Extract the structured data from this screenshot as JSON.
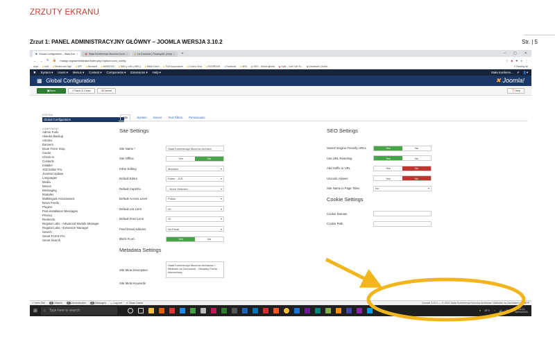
{
  "document": {
    "heading": "ZRZUTY EKRANU",
    "caption": "Zrzut 1: PANEL ADMINISTRACYJNY GŁÓWNY – JOOMLA WERSJA 3.10.2",
    "page": "Str. | 5"
  },
  "browser": {
    "tabs": [
      "Global Configuration – Stała Kon",
      "Stała Konferencja Muzeów Archi",
      "La Graciosa | Pewscycle, przep"
    ],
    "new_tab": "+",
    "url": "mabpp.org/administrator/index.php?option=com_config",
    "bookmarks": [
      "Apps",
      "m24",
      "Review and Sign",
      "SPF",
      "Microsoft",
      "WEBSITES",
      "NAS-y LAN-y WiFi-y",
      "Brexit Travel",
      "TCM Acupuncture",
      "Corona Virus",
      "FACEBOOK",
      "Facebook",
      "NRA",
      "SEO – Strona główna",
      "Kylie – Can't Get Yo...",
      "Dashboard | Action...",
      "Reading list"
    ]
  },
  "joomla": {
    "topmenu": [
      "System ▾",
      "Users ▾",
      "Menus ▾",
      "Content ▾",
      "Components ▾",
      "Extensions ▾",
      "Help ▾"
    ],
    "site_name_short": "Stała Konferen...",
    "title": "Global Configuration",
    "logo": "Joomla!",
    "toolbar": {
      "save": "Save",
      "save_close": "Save & Close",
      "cancel": "Cancel",
      "help": "Help"
    },
    "sidebar": {
      "system_label": "SYSTEM",
      "active": "Global Configuration",
      "component_label": "COMPONENT",
      "items": [
        "Admin Tools",
        "Akeeba Backup",
        "Articles",
        "Banners",
        "Brute Force Stop",
        "Cache",
        "Check-in",
        "Contacts",
        "Installer",
        "JCE Editor Pro",
        "Joomla! Update",
        "Languages",
        "Media",
        "Menus",
        "Messaging",
        "Modules",
        "Multilingual Associations",
        "News Feeds",
        "Plugins",
        "Post-installation Messages",
        "Privacy",
        "Redirects",
        "Regular Labs - Advanced Module Manager",
        "Regular Labs - Extension Manager",
        "Search",
        "Smart Forms Pro",
        "Smart Search"
      ]
    },
    "tabs": [
      "Site",
      "System",
      "Server",
      "Text Filters",
      "Permissions"
    ],
    "site_settings": {
      "heading": "Site Settings",
      "site_name_label": "Site Name *",
      "site_name_value": "Stała Konferencja Muzeów Archiwó",
      "offline_label": "Site Offline",
      "offline_yes": "Yes",
      "offline_no": "No",
      "inline_label": "Inline Editing",
      "inline_value": "Modules",
      "editor_label": "Default Editor",
      "editor_value": "Editor - JCE",
      "captcha_label": "Default Captcha",
      "captcha_value": "- None Selected -",
      "access_label": "Default Access Level",
      "access_value": "Public",
      "list_label": "Default List Limit",
      "list_value": "20",
      "feed_label": "Default Feed Limit",
      "feed_value": "10",
      "email_label": "Feed Email Address",
      "email_value": "No Email",
      "floc_label": "Block FLoC",
      "floc_yes": "Yes",
      "floc_no": "No"
    },
    "metadata": {
      "heading": "Metadata Settings",
      "desc_label": "Site Meta Description",
      "desc_value": "Stała Konferencja Muzeów Archiwów i Bibliotek na Zachodzie - Oficjalny Portal Internetowy",
      "keywords_label": "Site Meta Keywords"
    },
    "seo": {
      "heading": "SEO Settings",
      "sef_label": "Search Engine Friendly URLs",
      "sef_yes": "Yes",
      "sef_no": "No",
      "rewrite_label": "Use URL Rewriting",
      "rewrite_yes": "Yes",
      "rewrite_no": "No",
      "suffix_label": "Add Suffix to URL",
      "suffix_yes": "Yes",
      "suffix_no": "No",
      "unicode_label": "Unicode Aliases",
      "unicode_yes": "Yes",
      "unicode_no": "No",
      "names_label": "Site Name in Page Titles",
      "names_value": "No"
    },
    "cookie": {
      "heading": "Cookie Settings",
      "domain_label": "Cookie Domain",
      "path_label": "Cookie Path"
    },
    "status": {
      "view_site": "View Site",
      "visitors_count": "0",
      "visitors": "Visitors",
      "admin_count": "1",
      "admin": "Administrator",
      "messages_count": "0",
      "messages": "Messages",
      "logout": "Log out",
      "clean_cache": "Clean Cache",
      "copyright": "Joomla! 3.10.2 — © 2021 Stała Konferencja Muzeów Archiwów i Bibliotek na Zachodzie | MABPP"
    }
  },
  "taskbar": {
    "search": "Type here to search",
    "weather": "19°C",
    "lang": "POL",
    "time": "18:23",
    "date": "26/09/2021"
  },
  "colors": {
    "heading": "#c0392b",
    "annotation": "#f2b51b",
    "joomla_dark": "#1a3867"
  }
}
